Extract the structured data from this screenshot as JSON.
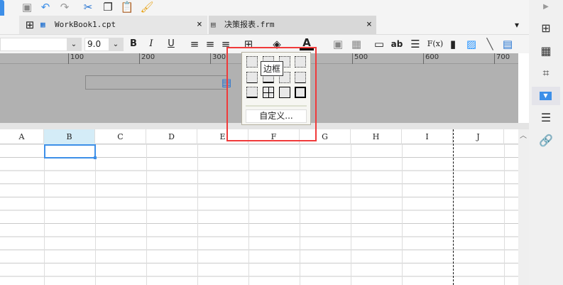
{
  "toolbar": {
    "icons": [
      "save-icon",
      "undo-icon",
      "redo-icon",
      "cut-icon",
      "copy-icon",
      "paste-icon",
      "format-brush-icon"
    ]
  },
  "tabs": [
    {
      "label": "WorkBook1.cpt",
      "active": true
    },
    {
      "label": "决策报表.frm",
      "active": false
    }
  ],
  "format": {
    "font_size": "9.0",
    "bold": "B",
    "italic": "I",
    "underline": "U",
    "text_label": "ab",
    "formula": "F(x)"
  },
  "ruler": [
    "100",
    "200",
    "300",
    "500",
    "600",
    "700"
  ],
  "columns": [
    "A",
    "B",
    "C",
    "D",
    "E",
    "F",
    "G",
    "H",
    "I",
    "J"
  ],
  "selected_cell": "B1",
  "border_menu": {
    "tooltip": "边框",
    "custom": "自定义..."
  },
  "accent": "#3d8fe8"
}
